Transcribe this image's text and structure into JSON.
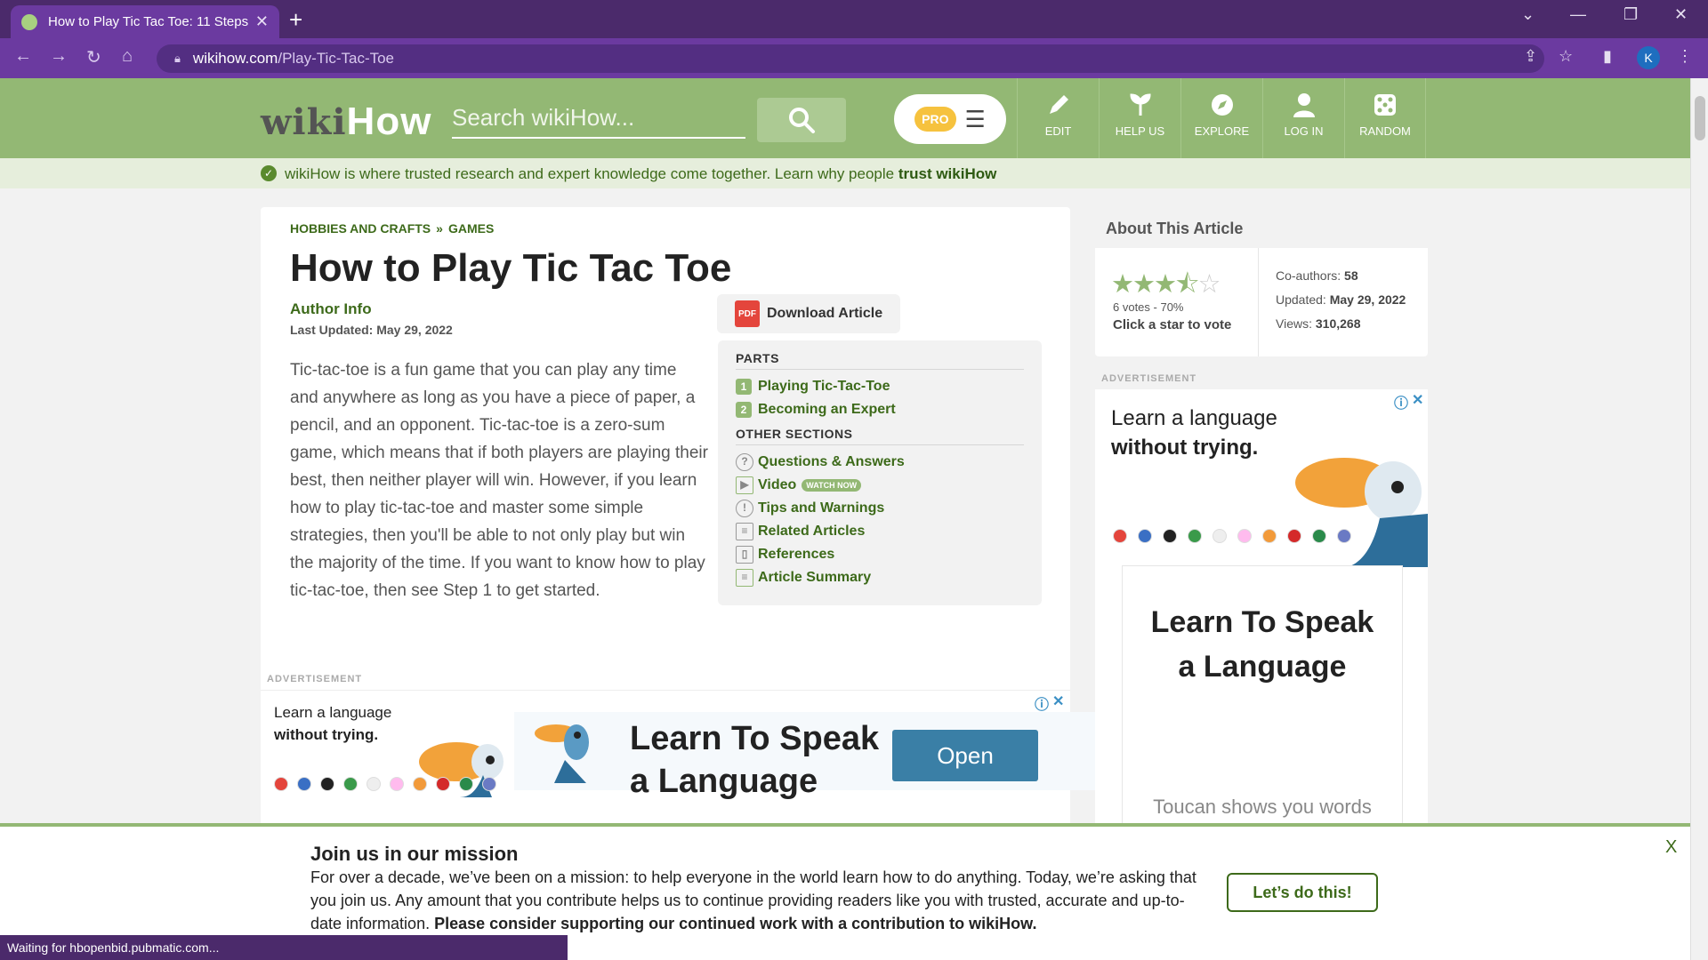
{
  "browser": {
    "tab_title": "How to Play Tic Tac Toe: 11 Steps",
    "tab_close": "✕",
    "new_tab": "+",
    "url_host": "wikihow.com",
    "url_path": "/Play-Tic-Tac-Toe",
    "profile_initial": "K",
    "status_text": "Waiting for hbopenbid.pubmatic.com..."
  },
  "header": {
    "logo_wiki": "wiki",
    "logo_how": "How",
    "search_placeholder": "Search wikiHow...",
    "pro_label": "PRO",
    "nav": [
      {
        "label": "EDIT"
      },
      {
        "label": "HELP US"
      },
      {
        "label": "EXPLORE"
      },
      {
        "label": "LOG IN"
      },
      {
        "label": "RANDOM"
      }
    ]
  },
  "trust": {
    "text": "wikiHow is where trusted research and expert knowledge come together. Learn why people ",
    "link": "trust wikiHow"
  },
  "article": {
    "breadcrumb": [
      "HOBBIES AND CRAFTS",
      "GAMES"
    ],
    "breadcrumb_sep": "»",
    "title": "How to Play Tic Tac Toe",
    "author_info": "Author Info",
    "last_updated": "Last Updated: May 29, 2022",
    "intro": "Tic-tac-toe is a fun game that you can play any time and anywhere as long as you have a piece of paper, a pencil, and an opponent. Tic-tac-toe is a zero-sum game, which means that if both players are playing their best, then neither player will win. However, if you learn how to play tic-tac-toe and master some simple strategies, then you'll be able to not only play but win the majority of the time. If you want to know how to play tic-tac-toe, then see Step 1 to get started.",
    "download_label": "Download Article",
    "pdf_label": "PDF"
  },
  "toc": {
    "parts_heading": "PARTS",
    "parts": [
      {
        "num": "1",
        "label": "Playing Tic-Tac-Toe"
      },
      {
        "num": "2",
        "label": "Becoming an Expert"
      }
    ],
    "other_heading": "OTHER SECTIONS",
    "other": [
      {
        "icon": "?",
        "label": "Questions & Answers"
      },
      {
        "icon": "▶",
        "label": "Video",
        "badge": "WATCH NOW"
      },
      {
        "icon": "!",
        "label": "Tips and Warnings"
      },
      {
        "icon": "≡",
        "label": "Related Articles"
      },
      {
        "icon": "▯",
        "label": "References"
      },
      {
        "icon": "≡",
        "label": "Article Summary"
      }
    ]
  },
  "ads": {
    "label": "ADVERTISEMENT",
    "learn_line1": "Learn a language",
    "learn_line2": "without trying.",
    "headline_line1": "Learn To Speak",
    "headline_line2": "a Language",
    "open_label": "Open",
    "side_sub": "Toucan shows you words",
    "info_icon": "ⓘ",
    "close_icon": "✕"
  },
  "about": {
    "heading": "About This Article",
    "rating": 3.5,
    "votes": "6 votes - 70%",
    "click_prompt": "Click a star to vote",
    "coauthors_label": "Co-authors:",
    "coauthors": "58",
    "updated_label": "Updated:",
    "updated": "May 29, 2022",
    "views_label": "Views:",
    "views": "310,268"
  },
  "mission": {
    "heading": "Join us in our mission",
    "body": "For over a decade, we’ve been on a mission: to help everyone in the world learn how to do anything. Today, we’re asking that you join us. Any amount that you contribute helps us to continue providing readers like you with trusted, accurate and up-to-date information. ",
    "body_bold": "Please consider supporting our continued work with a contribution to wikiHow.",
    "cta": "Let’s do this!",
    "close": "X"
  },
  "colors": {
    "brand_green": "#93b874",
    "link_green": "#3d6a1a",
    "browser_purple": "#6b3aa0",
    "ad_blue": "#3a7fa6"
  }
}
